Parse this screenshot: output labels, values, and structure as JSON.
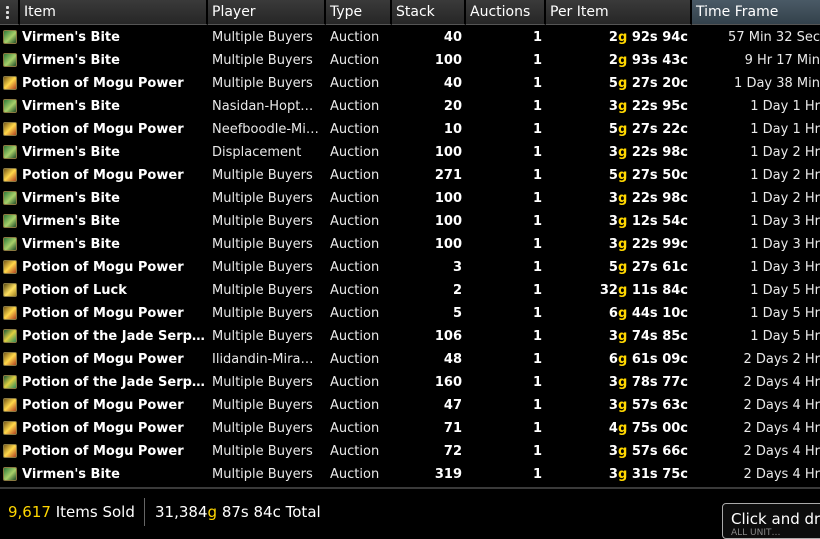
{
  "header": {
    "columns": [
      "Item",
      "Player",
      "Type",
      "Stack",
      "Auctions",
      "Per Item",
      "Time Frame"
    ],
    "active_column": "Time Frame"
  },
  "rows": [
    {
      "icon": "virmens-bite-icon",
      "item": "Virmen's Bite",
      "player": "Multiple Buyers",
      "type": "Auction",
      "stack": "40",
      "auctions": "1",
      "g": "2",
      "s": "92",
      "c": "94",
      "time": "57 Min 32 Sec"
    },
    {
      "icon": "virmens-bite-icon",
      "item": "Virmen's Bite",
      "player": "Multiple Buyers",
      "type": "Auction",
      "stack": "100",
      "auctions": "1",
      "g": "2",
      "s": "93",
      "c": "43",
      "time": "9 Hr 17 Min"
    },
    {
      "icon": "potion-mogu-power-icon",
      "item": "Potion of Mogu Power",
      "player": "Multiple Buyers",
      "type": "Auction",
      "stack": "40",
      "auctions": "1",
      "g": "5",
      "s": "27",
      "c": "20",
      "time": "1 Day 38 Min"
    },
    {
      "icon": "virmens-bite-icon",
      "item": "Virmen's Bite",
      "player": "Nasidan-Hopt…",
      "type": "Auction",
      "stack": "20",
      "auctions": "1",
      "g": "3",
      "s": "22",
      "c": "95",
      "time": "1 Day 1 Hr"
    },
    {
      "icon": "potion-mogu-power-icon",
      "item": "Potion of Mogu Power",
      "player": "Neefboodle-Mi…",
      "type": "Auction",
      "stack": "10",
      "auctions": "1",
      "g": "5",
      "s": "27",
      "c": "22",
      "time": "1 Day 1 Hr"
    },
    {
      "icon": "virmens-bite-icon",
      "item": "Virmen's Bite",
      "player": "Displacement",
      "type": "Auction",
      "stack": "100",
      "auctions": "1",
      "g": "3",
      "s": "22",
      "c": "98",
      "time": "1 Day 2 Hr"
    },
    {
      "icon": "potion-mogu-power-icon",
      "item": "Potion of Mogu Power",
      "player": "Multiple Buyers",
      "type": "Auction",
      "stack": "271",
      "auctions": "1",
      "g": "5",
      "s": "27",
      "c": "50",
      "time": "1 Day 2 Hr"
    },
    {
      "icon": "virmens-bite-icon",
      "item": "Virmen's Bite",
      "player": "Multiple Buyers",
      "type": "Auction",
      "stack": "100",
      "auctions": "1",
      "g": "3",
      "s": "22",
      "c": "98",
      "time": "1 Day 2 Hr"
    },
    {
      "icon": "virmens-bite-icon",
      "item": "Virmen's Bite",
      "player": "Multiple Buyers",
      "type": "Auction",
      "stack": "100",
      "auctions": "1",
      "g": "3",
      "s": "12",
      "c": "54",
      "time": "1 Day 3 Hr"
    },
    {
      "icon": "virmens-bite-icon",
      "item": "Virmen's Bite",
      "player": "Multiple Buyers",
      "type": "Auction",
      "stack": "100",
      "auctions": "1",
      "g": "3",
      "s": "22",
      "c": "99",
      "time": "1 Day 3 Hr"
    },
    {
      "icon": "potion-mogu-power-icon",
      "item": "Potion of Mogu Power",
      "player": "Multiple Buyers",
      "type": "Auction",
      "stack": "3",
      "auctions": "1",
      "g": "5",
      "s": "27",
      "c": "61",
      "time": "1 Day 3 Hr"
    },
    {
      "icon": "potion-luck-icon",
      "item": "Potion of Luck",
      "player": "Multiple Buyers",
      "type": "Auction",
      "stack": "2",
      "auctions": "1",
      "g": "32",
      "s": "11",
      "c": "84",
      "time": "1 Day 5 Hr"
    },
    {
      "icon": "potion-mogu-power-icon",
      "item": "Potion of Mogu Power",
      "player": "Multiple Buyers",
      "type": "Auction",
      "stack": "5",
      "auctions": "1",
      "g": "6",
      "s": "44",
      "c": "10",
      "time": "1 Day 5 Hr"
    },
    {
      "icon": "potion-jade-serpent-icon",
      "item": "Potion of the Jade Serp…",
      "player": "Multiple Buyers",
      "type": "Auction",
      "stack": "106",
      "auctions": "1",
      "g": "3",
      "s": "74",
      "c": "85",
      "time": "1 Day 5 Hr"
    },
    {
      "icon": "potion-mogu-power-icon",
      "item": "Potion of Mogu Power",
      "player": "Ilidandin-Mira…",
      "type": "Auction",
      "stack": "48",
      "auctions": "1",
      "g": "6",
      "s": "61",
      "c": "09",
      "time": "2 Days 2 Hr"
    },
    {
      "icon": "potion-jade-serpent-icon",
      "item": "Potion of the Jade Serp…",
      "player": "Multiple Buyers",
      "type": "Auction",
      "stack": "160",
      "auctions": "1",
      "g": "3",
      "s": "78",
      "c": "77",
      "time": "2 Days 4 Hr"
    },
    {
      "icon": "potion-mogu-power-icon",
      "item": "Potion of Mogu Power",
      "player": "Multiple Buyers",
      "type": "Auction",
      "stack": "47",
      "auctions": "1",
      "g": "3",
      "s": "57",
      "c": "63",
      "time": "2 Days 4 Hr"
    },
    {
      "icon": "potion-mogu-power-icon",
      "item": "Potion of Mogu Power",
      "player": "Multiple Buyers",
      "type": "Auction",
      "stack": "71",
      "auctions": "1",
      "g": "4",
      "s": "75",
      "c": "00",
      "time": "2 Days 4 Hr"
    },
    {
      "icon": "potion-mogu-power-icon",
      "item": "Potion of Mogu Power",
      "player": "Multiple Buyers",
      "type": "Auction",
      "stack": "72",
      "auctions": "1",
      "g": "3",
      "s": "57",
      "c": "66",
      "time": "2 Days 4 Hr"
    },
    {
      "icon": "virmens-bite-icon",
      "item": "Virmen's Bite",
      "player": "Multiple Buyers",
      "type": "Auction",
      "stack": "319",
      "auctions": "1",
      "g": "3",
      "s": "31",
      "c": "75",
      "time": "2 Days 4 Hr"
    }
  ],
  "money_suffix": {
    "g": "g",
    "s": "s",
    "c": "c"
  },
  "footer": {
    "items_sold_count": "9,617",
    "items_sold_label": "Items Sold",
    "total_g": "31,384",
    "total_s": "87",
    "total_c": "84",
    "total_label": "Total"
  },
  "tooltip": {
    "text": "Click and dr",
    "sub": "ALL UNIT…"
  },
  "colors": {
    "gold": "#ffd700",
    "background": "#000000",
    "header": "#2f2f2f",
    "active_header": "#3b4a55"
  }
}
